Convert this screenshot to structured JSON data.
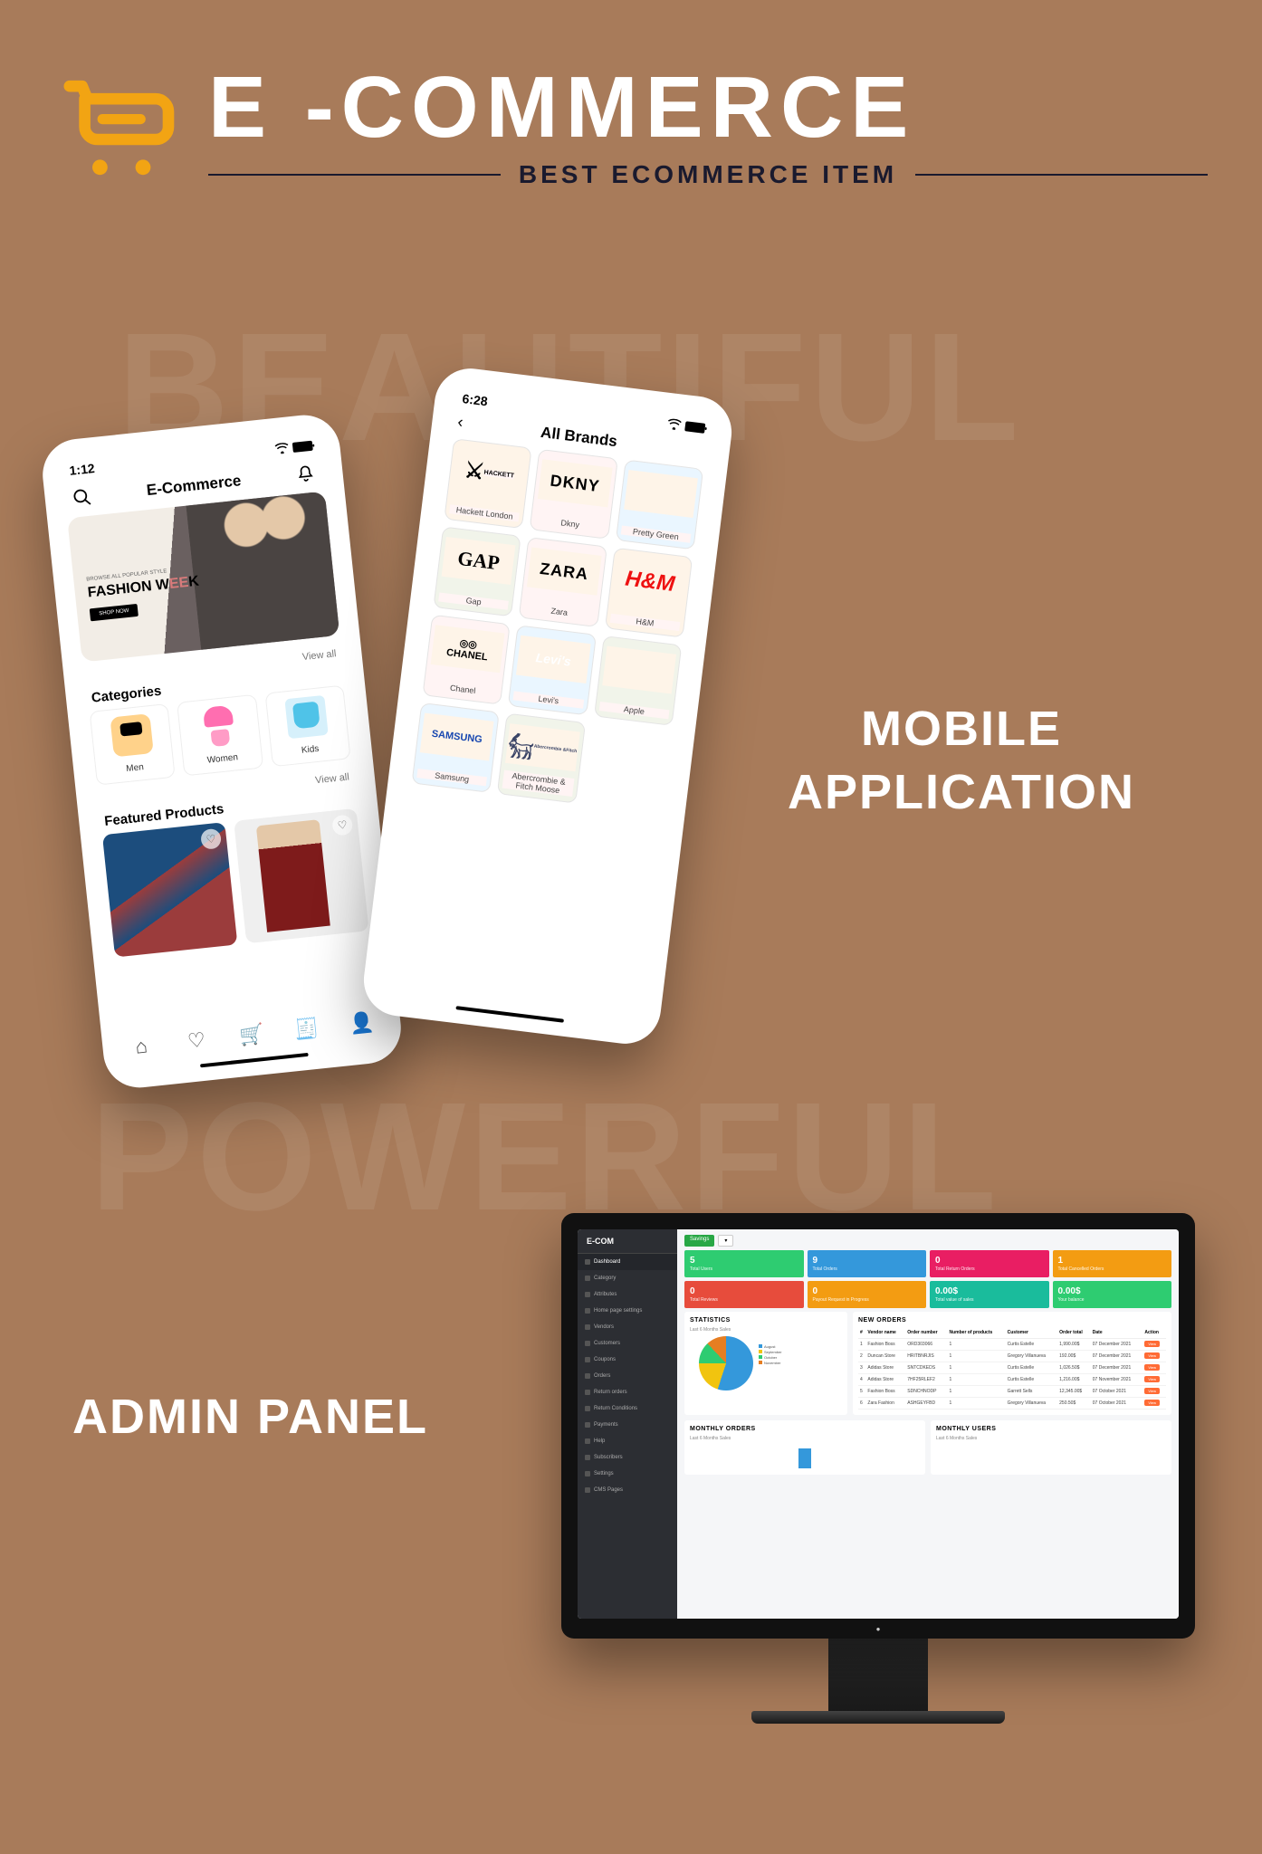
{
  "header": {
    "title": "E -COMMERCE",
    "subtitle": "BEST ECOMMERCE ITEM"
  },
  "bg_words": {
    "beautiful": "BEAUTIFUL",
    "powerful": "POWERFUL"
  },
  "section_labels": {
    "mobile_1": "MOBILE",
    "mobile_2": "APPLICATION",
    "admin": "ADMIN PANEL"
  },
  "phone1": {
    "time": "1:12",
    "app_title": "E-Commerce",
    "banner_small": "BROWSE ALL POPULAR STYLE",
    "banner_title_1": "FASHION W",
    "banner_title_2": "EE",
    "banner_title_3": "K",
    "banner_btn": "SHOP NOW",
    "view_all": "View all",
    "categories_label": "Categories",
    "categories": [
      {
        "label": "Men"
      },
      {
        "label": "Women"
      },
      {
        "label": "Kids"
      }
    ],
    "featured_label": "Featured Products"
  },
  "phone2": {
    "time": "6:28",
    "title": "All Brands",
    "brands": [
      {
        "label": "Hackett London"
      },
      {
        "label": "Dkny"
      },
      {
        "label": "Pretty Green"
      },
      {
        "label": "Gap"
      },
      {
        "label": "Zara"
      },
      {
        "label": "H&M"
      },
      {
        "label": "Chanel"
      },
      {
        "label": "Levi's"
      },
      {
        "label": "Apple"
      },
      {
        "label": "Samsung"
      },
      {
        "label": "Abercrombie & Fitch Moose"
      }
    ]
  },
  "admin": {
    "brand": "E-COM",
    "badge_left": "Savings",
    "sidebar": [
      "Dashboard",
      "Category",
      "Attributes",
      "Home page settings",
      "Vendors",
      "Customers",
      "Coupons",
      "Orders",
      "Return orders",
      "Return Conditions",
      "Payments",
      "Help",
      "Subscribers",
      "Settings",
      "CMS Pages"
    ],
    "stats_row1": [
      {
        "value": "5",
        "label": "Total Users"
      },
      {
        "value": "9",
        "label": "Total Orders"
      },
      {
        "value": "0",
        "label": "Total Return Orders"
      },
      {
        "value": "1",
        "label": "Total Cancelled Orders"
      }
    ],
    "stats_row2": [
      {
        "value": "0",
        "label": "Total Reviews"
      },
      {
        "value": "0",
        "label": "Payout Request in Progress"
      },
      {
        "value": "0.00$",
        "label": "Total value of sales"
      },
      {
        "value": "0.00$",
        "label": "Your balance"
      }
    ],
    "statistics_title": "STATISTICS",
    "statistics_sub": "Last 6 Months Sales",
    "orders_title": "NEW ORDERS",
    "orders_cols": [
      "#",
      "Vendor name",
      "Order number",
      "Number of products",
      "Customer",
      "Order total",
      "Date",
      "Action"
    ],
    "orders": [
      {
        "n": "1",
        "vendor": "Fashion Boss",
        "num": "ORD303066",
        "p": "1",
        "cust": "Curtis Estelle",
        "total": "1,990.00$",
        "date": "07 December 2021"
      },
      {
        "n": "2",
        "vendor": "Duncan Store",
        "num": "HRITBNRJIS",
        "p": "1",
        "cust": "Gregory Villanueva",
        "total": "192.00$",
        "date": "07 December 2021"
      },
      {
        "n": "3",
        "vendor": "Adidas Store",
        "num": "SNTCDKEDS",
        "p": "1",
        "cust": "Curtis Estelle",
        "total": "1,026.50$",
        "date": "07 December 2021"
      },
      {
        "n": "4",
        "vendor": "Adidas Store",
        "num": "7HF25RLEF2",
        "p": "1",
        "cust": "Curtis Estelle",
        "total": "1,216.00$",
        "date": "07 November 2021"
      },
      {
        "n": "5",
        "vendor": "Fashion Boss",
        "num": "SDNCHNODP",
        "p": "1",
        "cust": "Garrett Sells",
        "total": "12,345.00$",
        "date": "07 October 2021"
      },
      {
        "n": "6",
        "vendor": "Zara Fashion",
        "num": "ASHGEYFBD",
        "p": "1",
        "cust": "Gregory Villanueva",
        "total": "250.50$",
        "date": "07 October 2021"
      }
    ],
    "monthly_orders_title": "MONTHLY ORDERS",
    "monthly_users_title": "MONTHLY USERS",
    "monthly_sub": "Last 6 Months Sales",
    "action_label": "View"
  },
  "chart_data": {
    "type": "pie",
    "title": "Last 6 Months Sales",
    "series": [
      {
        "name": "August",
        "value": 55
      },
      {
        "name": "September",
        "value": 20
      },
      {
        "name": "October",
        "value": 13
      },
      {
        "name": "November",
        "value": 12
      }
    ]
  }
}
